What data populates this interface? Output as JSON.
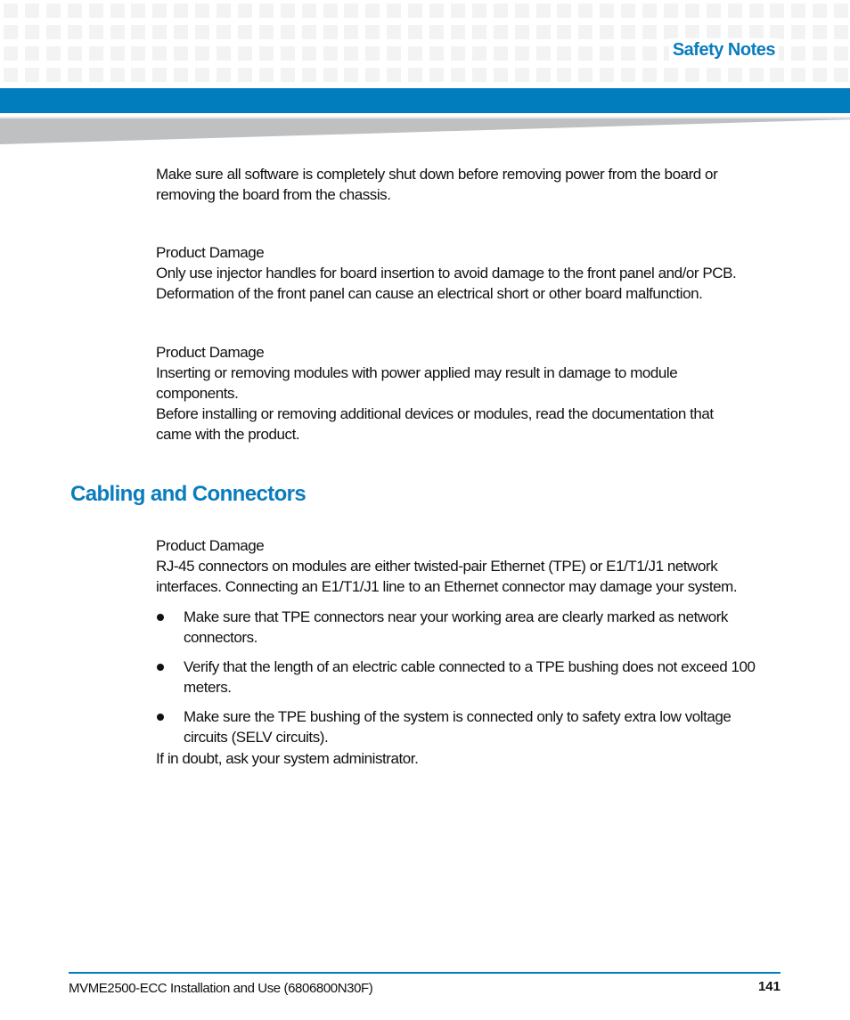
{
  "header": {
    "section_title": "Safety Notes",
    "colors": {
      "accent_blue": "#017cbd",
      "title_blue": "#0a7cbe",
      "wedge_grey": "#bfc0c2",
      "grid_grey": "#f3f3f3"
    }
  },
  "notes": [
    {
      "label": "",
      "lines": [
        "Make sure all software is completely shut down before removing power from the board or",
        "removing the board from the chassis."
      ]
    },
    {
      "label": "Product Damage",
      "lines": [
        "Only use injector handles for board insertion to avoid damage to the front panel and/or PCB.",
        "Deformation of the front panel can cause an electrical short or other board malfunction."
      ]
    },
    {
      "label": "Product Damage",
      "lines": [
        "Inserting or removing modules with power applied may result in damage to module",
        "components.",
        "Before installing or removing additional devices or modules, read the documentation that",
        "came with the product."
      ]
    }
  ],
  "cabling_section": {
    "heading": "Cabling and Connectors",
    "note": {
      "label": "Product Damage",
      "lines": [
        "RJ-45 connectors on modules are either twisted-pair Ethernet (TPE) or E1/T1/J1 network",
        "interfaces. Connecting an E1/T1/J1 line to an Ethernet connector may damage your system."
      ]
    },
    "bullets": [
      {
        "lines": [
          "Make sure that TPE connectors near your working area are clearly marked as network",
          "connectors."
        ]
      },
      {
        "lines": [
          "Verify that the length of an electric cable connected to a TPE bushing does not exceed 100",
          "meters."
        ]
      },
      {
        "lines": [
          "Make sure the TPE bushing of the system is connected only to safety extra low voltage",
          "circuits (SELV circuits)."
        ]
      }
    ],
    "closing": "If in doubt, ask your system administrator."
  },
  "footer": {
    "document_title": "MVME2500-ECC Installation and Use (6806800N30F)",
    "page_number": "141"
  }
}
